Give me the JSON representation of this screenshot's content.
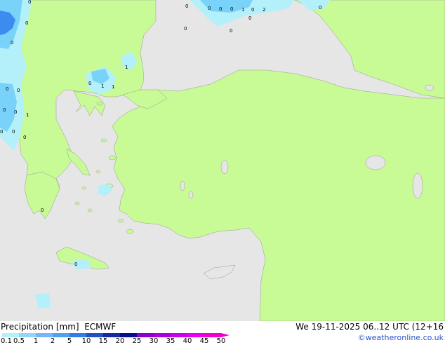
{
  "footer": {
    "title_left": "Precipitation [mm]  ECMWF",
    "title_right": "We 19-11-2025 06..12 UTC (12+16",
    "credit": "©weatheronline.co.uk"
  },
  "legend": {
    "ticks": [
      "0.1",
      "0.5",
      "1",
      "2",
      "5",
      "10",
      "15",
      "20",
      "25",
      "30",
      "35",
      "40",
      "45",
      "50"
    ],
    "colors": [
      "#b4f0fa",
      "#96d2fa",
      "#78b4fa",
      "#50a0f0",
      "#2f7de6",
      "#1e50c8",
      "#1428aa",
      "#0a0a8c",
      "#8c00c8",
      "#a800e0",
      "#c800f0",
      "#e600f0",
      "#f000c8"
    ]
  },
  "map": {
    "colors": {
      "sea": "#e6e6e6",
      "land": "#c8fa96",
      "precip_light": "#b4f0fa",
      "precip_medium": "#78d2fa",
      "precip_heavy": "#3c8cf0"
    },
    "labels": [
      {
        "id": "l1",
        "text": "0"
      },
      {
        "id": "l2",
        "text": "0"
      },
      {
        "id": "l3",
        "text": "0"
      },
      {
        "id": "l4",
        "text": "0"
      },
      {
        "id": "l5",
        "text": "0"
      },
      {
        "id": "l6",
        "text": "0"
      },
      {
        "id": "l7",
        "text": "1"
      },
      {
        "id": "l8",
        "text": "0"
      },
      {
        "id": "l9",
        "text": "2"
      },
      {
        "id": "l10",
        "text": "0"
      },
      {
        "id": "l11",
        "text": "0"
      },
      {
        "id": "l12",
        "text": "0"
      },
      {
        "id": "l13",
        "text": "0"
      },
      {
        "id": "l14",
        "text": "0"
      },
      {
        "id": "l15",
        "text": "1"
      },
      {
        "id": "l16",
        "text": "0"
      },
      {
        "id": "l17",
        "text": "1"
      },
      {
        "id": "l18",
        "text": "1"
      },
      {
        "id": "l19",
        "text": "0"
      },
      {
        "id": "l20",
        "text": "0"
      },
      {
        "id": "l21",
        "text": "0"
      },
      {
        "id": "l22",
        "text": "0"
      },
      {
        "id": "l23",
        "text": "1"
      },
      {
        "id": "l24",
        "text": "0"
      },
      {
        "id": "l25",
        "text": "0"
      },
      {
        "id": "l26",
        "text": "0"
      },
      {
        "id": "l27",
        "text": "0"
      },
      {
        "id": "l28",
        "text": "0"
      }
    ]
  }
}
